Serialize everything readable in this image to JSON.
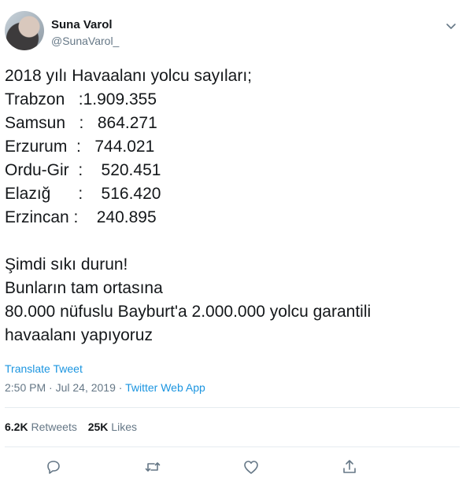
{
  "user": {
    "name": "Suna Varol",
    "handle": "@SunaVarol_"
  },
  "tweet": {
    "lines": [
      "2018 yılı Havaalanı yolcu sayıları;",
      "Trabzon   :1.909.355",
      "Samsun   :   864.271",
      "Erzurum  :   744.021",
      "Ordu-Gir  :    520.451",
      "Elazığ      :    516.420",
      "Erzincan :    240.895",
      "",
      "Şimdi sıkı durun!",
      "Bunların tam ortasına",
      "80.000 nüfuslu Bayburt'a 2.000.000 yolcu garantili",
      "havaalanı yapıyoruz"
    ],
    "translate_label": "Translate Tweet",
    "time": "2:50 PM",
    "separator": " · ",
    "date": "Jul 24, 2019",
    "source": "Twitter Web App"
  },
  "stats": {
    "retweets_count": "6.2K",
    "retweets_label": "Retweets",
    "likes_count": "25K",
    "likes_label": "Likes"
  },
  "icons": {
    "chevron": "chevron-down-icon",
    "reply": "reply-icon",
    "retweet": "retweet-icon",
    "like": "heart-icon",
    "share": "share-icon"
  },
  "colors": {
    "link": "#1b95e0",
    "muted": "#657786",
    "text": "#14171a",
    "divider": "#e6ecf0"
  }
}
